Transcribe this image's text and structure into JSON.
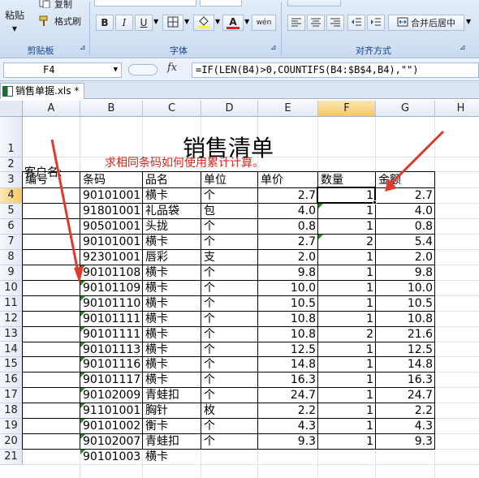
{
  "ribbon": {
    "paste_label": "粘贴",
    "copy_label": "复制",
    "format_painter_label": "格式刷",
    "clipboard_group": "剪贴板",
    "font_group": "字体",
    "align_group": "对齐方式",
    "bold_label": "B",
    "italic_label": "I",
    "underline_label": "U",
    "font_color_label": "A",
    "phonetic_label": "wén",
    "merge_label": "合并后居中"
  },
  "formula_bar": {
    "cell_ref": "F4",
    "fx_label": "fx",
    "formula": "=IF(LEN(B4)>0,COUNTIFS(B4:$B$4,B4),\"\")"
  },
  "workbook_tab": {
    "label": "销售单据.xls *"
  },
  "columns": [
    "A",
    "B",
    "C",
    "D",
    "E",
    "F",
    "G",
    "H"
  ],
  "rows": [
    "1",
    "2",
    "3",
    "4",
    "5",
    "6",
    "7",
    "8",
    "9",
    "10",
    "11",
    "12",
    "13",
    "14",
    "15",
    "16",
    "17",
    "18",
    "19",
    "20",
    "21"
  ],
  "sheet": {
    "title": "销售清单",
    "customer_label": "客户名:",
    "annotation": "求相同条码如何使用累计计算。",
    "headers": [
      "编号",
      "条码",
      "品名",
      "单位",
      "单价",
      "数量",
      "金额"
    ],
    "records": [
      [
        "90101001",
        "横卡",
        "个",
        "2.7",
        "1",
        "2.7"
      ],
      [
        "91801001",
        "礼品袋",
        "包",
        "4.0",
        "1",
        "4.0"
      ],
      [
        "90501001",
        "头拢",
        "个",
        "0.8",
        "1",
        "0.8"
      ],
      [
        "90101001",
        "横卡",
        "个",
        "2.7",
        "2",
        "5.4"
      ],
      [
        "92301001",
        "唇彩",
        "支",
        "2.0",
        "1",
        "2.0"
      ],
      [
        "90101108",
        "横卡",
        "个",
        "9.8",
        "1",
        "9.8"
      ],
      [
        "90101109",
        "横卡",
        "个",
        "10.0",
        "1",
        "10.0"
      ],
      [
        "90101110",
        "横卡",
        "个",
        "10.5",
        "1",
        "10.5"
      ],
      [
        "90101111",
        "横卡",
        "个",
        "10.8",
        "1",
        "10.8"
      ],
      [
        "90101111",
        "横卡",
        "个",
        "10.8",
        "2",
        "21.6"
      ],
      [
        "90101113",
        "横卡",
        "个",
        "12.5",
        "1",
        "12.5"
      ],
      [
        "90101116",
        "横卡",
        "个",
        "14.8",
        "1",
        "14.8"
      ],
      [
        "90101117",
        "横卡",
        "个",
        "16.3",
        "1",
        "16.3"
      ],
      [
        "90102009",
        "青蛙扣",
        "个",
        "24.7",
        "1",
        "24.7"
      ],
      [
        "91101001",
        "胸针",
        "枚",
        "2.2",
        "1",
        "2.2"
      ],
      [
        "90101002",
        "衡卡",
        "个",
        "4.3",
        "1",
        "4.3"
      ],
      [
        "90102007",
        "青蛙扣",
        "个",
        "9.3",
        "1",
        "9.3"
      ],
      [
        "90101003",
        "横卡",
        "",
        "",
        "",
        ""
      ]
    ]
  },
  "colors": {
    "annotation": "#d9261c",
    "arrow": "#e03a2a",
    "error_marker": "#1c8c1c",
    "selected_header": "#f7d98c"
  }
}
